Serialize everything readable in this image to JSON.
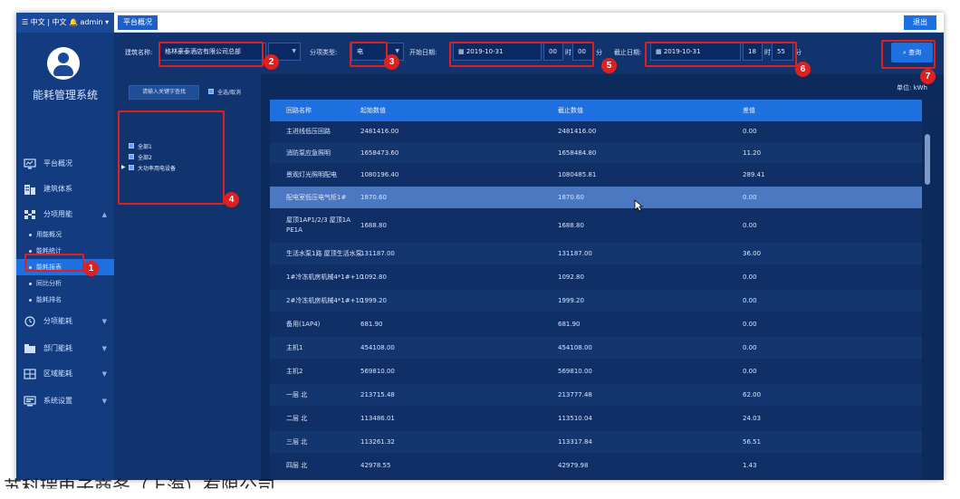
{
  "topbar": {
    "left_text": "☰ 中文 | 中文 🔔 admin ▾",
    "tab": "平台概况",
    "exit": "退出"
  },
  "sidebar": {
    "system_name": "能耗管理系统",
    "items": [
      {
        "label": "平台概况",
        "icon": "monitor-icon"
      },
      {
        "label": "建筑体系",
        "icon": "building-icon"
      },
      {
        "label": "分项用能",
        "icon": "network-icon"
      },
      {
        "label": "分项能耗",
        "icon": "clock-icon"
      },
      {
        "label": "部门能耗",
        "icon": "folder-icon"
      },
      {
        "label": "区域能耗",
        "icon": "grid-icon"
      },
      {
        "label": "系统设置",
        "icon": "settings-icon"
      }
    ],
    "sub_items": [
      "用能概况",
      "能耗统计",
      "能耗报表",
      "同比分析",
      "能耗排名"
    ]
  },
  "filters": {
    "building_label": "建筑名称:",
    "building_value": "格林豪泰酒店有限公司总部",
    "type_label": "分项类型:",
    "type_value": "电",
    "start_label": "开始日期:",
    "start_date": "2019-10-31",
    "start_hour": "00",
    "hour_unit": "时",
    "start_min": "00",
    "min_unit": "分",
    "end_label": "截止日期:",
    "end_date": "2019-10-31",
    "end_hour": "18",
    "end_min": "55",
    "query": "查询"
  },
  "left_panel": {
    "search_placeholder": "请输入关键字查找",
    "select_all": "全选/取消",
    "tree": [
      "全部1",
      "全部2",
      "大功率用电设备"
    ]
  },
  "unit": "单位: kWh",
  "table": {
    "headers": [
      "回路名称",
      "起始数值",
      "截止数值",
      "差值"
    ],
    "rows": [
      [
        "主进线低压回路",
        "2481416.00",
        "2481416.00",
        "0.00"
      ],
      [
        "消防泵应急照明",
        "1658473.60",
        "1658484.80",
        "11.20"
      ],
      [
        "景观灯光照明配电",
        "1080196.40",
        "1080485.81",
        "289.41"
      ],
      [
        "配电室低压电气柜1#",
        "1870.60",
        "1870.60",
        "0.00"
      ],
      [
        "屋顶1AP1/2/3  屋顶1A PE1A",
        "1688.80",
        "1688.80",
        "0.00"
      ],
      [
        "生活水泵1路  屋顶生活水泵",
        "131187.00",
        "131187.00",
        "36.00"
      ],
      [
        "1#冷冻机房机械4*1#+10",
        "1092.80",
        "1092.80",
        "0.00"
      ],
      [
        "2#冷冻机房机械4*1#+10",
        "1999.20",
        "1999.20",
        "0.00"
      ],
      [
        "备用(1AP4)",
        "681.90",
        "681.90",
        "0.00"
      ],
      [
        "主机1",
        "454108.00",
        "454108.00",
        "0.00"
      ],
      [
        "主机2",
        "569810.00",
        "569810.00",
        "0.00"
      ],
      [
        "一层 北",
        "213715.48",
        "213777.48",
        "62.00"
      ],
      [
        "二层 北",
        "113486.01",
        "113510.04",
        "24.03"
      ],
      [
        "三层 北",
        "113261.32",
        "113317.84",
        "56.51"
      ],
      [
        "四层 北",
        "42978.55",
        "42979.98",
        "1.43"
      ]
    ]
  },
  "annotations": [
    "1",
    "2",
    "3",
    "4",
    "5",
    "6",
    "7"
  ],
  "watermark": "苏科瑞电子商务（上海）有限公司",
  "colors": {
    "accent": "#1e6fe0",
    "annotation": "#e02020",
    "background": "#0d2a5c"
  }
}
